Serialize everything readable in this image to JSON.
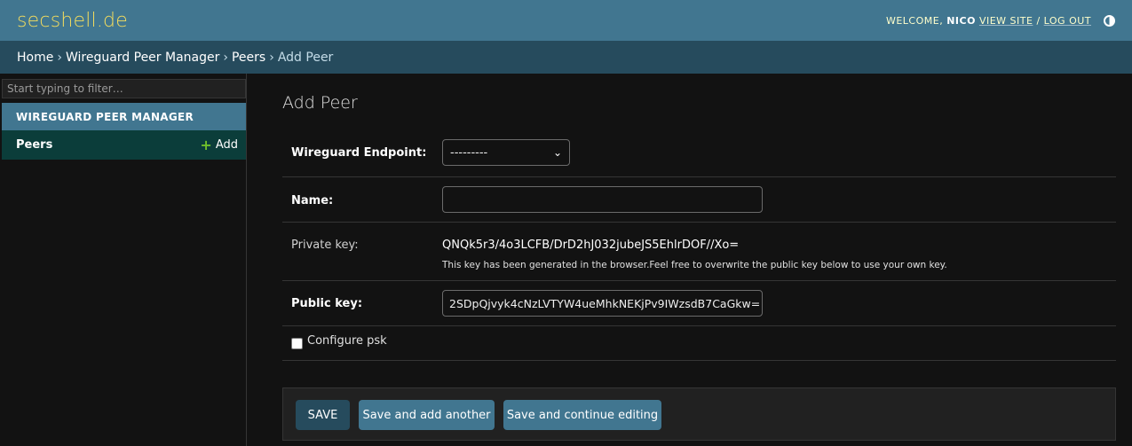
{
  "header": {
    "brand": "secshell.de",
    "welcome": "WELCOME,",
    "user": "NICO",
    "view_site": "VIEW SITE",
    "separator": "/",
    "log_out": "LOG OUT"
  },
  "breadcrumbs": {
    "home": "Home",
    "app": "Wireguard Peer Manager",
    "model": "Peers",
    "current": "Add Peer",
    "sep": "›"
  },
  "sidebar": {
    "filter_placeholder": "Start typing to filter…",
    "app_caption": "Wireguard Peer Manager",
    "model_label": "Peers",
    "add_label": "Add",
    "add_icon": "plus-icon"
  },
  "form": {
    "title": "Add Peer",
    "endpoint_label": "Wireguard Endpoint:",
    "endpoint_selected": "---------",
    "name_label": "Name:",
    "name_value": "",
    "private_label": "Private key:",
    "private_value": "QNQk5r3/4o3LCFB/DrD2hJ032jubeJS5EhlrDOF//Xo=",
    "private_help": "This key has been generated in the browser.Feel free to overwrite the public key below to use your own key.",
    "public_label": "Public key:",
    "public_value": "2SDpQjvyk4cNzLVTYW4ueMhkNEKjPv9IWzsdB7CaGkw=",
    "psk_label": "Configure psk",
    "psk_checked": false
  },
  "submit": {
    "save": "SAVE",
    "save_add": "Save and add another",
    "save_continue": "Save and continue editing"
  },
  "colors": {
    "header_bg": "#417690",
    "breadcrumb_bg": "#264b5d",
    "brand": "#f5dd5d",
    "accent_green": "#70bf2b"
  }
}
